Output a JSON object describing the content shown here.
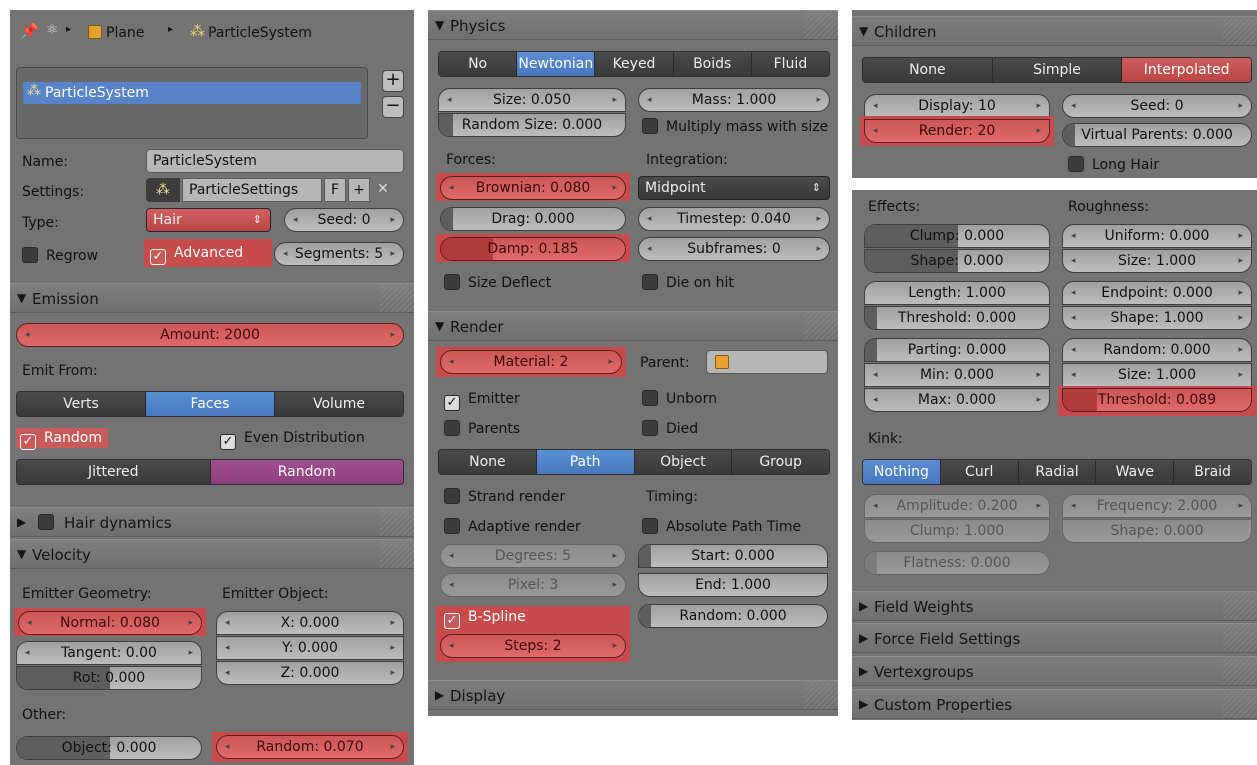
{
  "left": {
    "breadcrumb": {
      "object": "Plane",
      "system": "ParticleSystem"
    },
    "list_item": "ParticleSystem",
    "name_label": "Name:",
    "name_value": "ParticleSystem",
    "settings_label": "Settings:",
    "settings_value": "ParticleSettings",
    "settings_f": "F",
    "type_label": "Type:",
    "type_value": "Hair",
    "seed": "Seed: 0",
    "regrow": "Regrow",
    "advanced": "Advanced",
    "segments": "Segments: 5",
    "emission": "Emission",
    "amount": "Amount: 2000",
    "emit_from": "Emit From:",
    "emit_tabs": [
      "Verts",
      "Faces",
      "Volume"
    ],
    "random": "Random",
    "even_dist": "Even Distribution",
    "dist_tabs": [
      "Jittered",
      "Random"
    ],
    "hair_dynamics": "Hair dynamics",
    "velocity": "Velocity",
    "emitter_geometry": "Emitter Geometry:",
    "emitter_object": "Emitter Object:",
    "normal": "Normal: 0.080",
    "tangent": "Tangent: 0.00",
    "rot": "Rot: 0.000",
    "x": "X: 0.000",
    "y": "Y: 0.000",
    "z": "Z: 0.000",
    "other": "Other:",
    "object": "Object: 0.000",
    "vrandom": "Random: 0.070"
  },
  "middle": {
    "physics": "Physics",
    "phys_tabs": [
      "No",
      "Newtonian",
      "Keyed",
      "Boids",
      "Fluid"
    ],
    "size": "Size: 0.050",
    "mass": "Mass: 1.000",
    "random_size": "Random Size: 0.000",
    "multiply_mass": "Multiply mass with size",
    "forces": "Forces:",
    "integration": "Integration:",
    "brownian": "Brownian: 0.080",
    "integration_value": "Midpoint",
    "drag": "Drag: 0.000",
    "timestep": "Timestep: 0.040",
    "damp": "Damp: 0.185",
    "subframes": "Subframes: 0",
    "size_deflect": "Size Deflect",
    "die_on_hit": "Die on hit",
    "render": "Render",
    "material": "Material: 2",
    "parent": "Parent:",
    "emitter": "Emitter",
    "unborn": "Unborn",
    "parents": "Parents",
    "died": "Died",
    "render_tabs": [
      "None",
      "Path",
      "Object",
      "Group"
    ],
    "strand_render": "Strand render",
    "timing": "Timing:",
    "adaptive_render": "Adaptive render",
    "absolute_path_time": "Absolute Path Time",
    "degrees": "Degrees: 5",
    "start": "Start: 0.000",
    "pixel": "Pixel: 3",
    "end": "End: 1.000",
    "bspline": "B-Spline",
    "rrandom": "Random: 0.000",
    "steps": "Steps: 2",
    "display": "Display"
  },
  "right": {
    "children": "Children",
    "child_tabs": [
      "None",
      "Simple",
      "Interpolated"
    ],
    "display": "Display: 10",
    "seed": "Seed: 0",
    "render": "Render: 20",
    "virtual_parents": "Virtual Parents: 0.000",
    "long_hair": "Long Hair",
    "effects": "Effects:",
    "roughness": "Roughness:",
    "clump": "Clump: 0.000",
    "uniform": "Uniform: 0.000",
    "shape": "Shape: 0.000",
    "usize": "Size: 1.000",
    "length": "Length: 1.000",
    "endpoint": "Endpoint: 0.000",
    "threshold": "Threshold: 0.000",
    "eshape": "Shape: 1.000",
    "parting": "Parting: 0.000",
    "rrandom": "Random: 0.000",
    "min": "Min: 0.000",
    "rsize": "Size: 1.000",
    "max": "Max: 0.000",
    "rthreshold": "Threshold: 0.089",
    "kink": "Kink:",
    "kink_tabs": [
      "Nothing",
      "Curl",
      "Radial",
      "Wave",
      "Braid"
    ],
    "amplitude": "Amplitude: 0.200",
    "frequency": "Frequency: 2.000",
    "kclump": "Clump: 1.000",
    "kshape": "Shape: 0.000",
    "flatness": "Flatness: 0.000",
    "field_weights": "Field Weights",
    "force_field": "Force Field Settings",
    "vertexgroups": "Vertexgroups",
    "custom_props": "Custom Properties"
  }
}
